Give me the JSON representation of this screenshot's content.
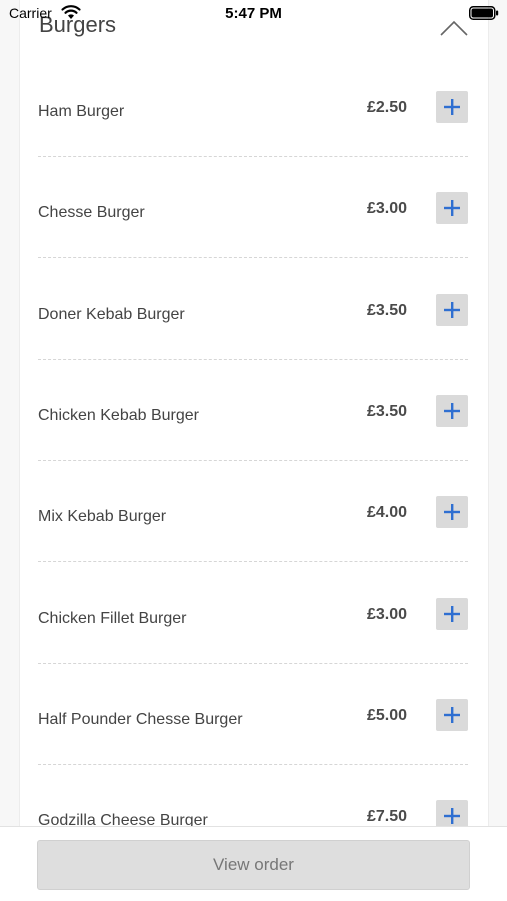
{
  "status_bar": {
    "carrier": "Carrier",
    "time": "5:47 PM"
  },
  "menu": {
    "section_title": "Burgers",
    "items": [
      {
        "name": "Ham Burger",
        "price": "£2.50"
      },
      {
        "name": "Chesse Burger",
        "price": "£3.00"
      },
      {
        "name": "Doner Kebab Burger",
        "price": "£3.50"
      },
      {
        "name": "Chicken Kebab Burger",
        "price": "£3.50"
      },
      {
        "name": "Mix Kebab Burger",
        "price": "£4.00"
      },
      {
        "name": "Chicken Fillet Burger",
        "price": "£3.00"
      },
      {
        "name": "Half Pounder Chesse Burger",
        "price": "£5.00"
      },
      {
        "name": "Godzilla Cheese Burger",
        "price": "£7.50"
      }
    ]
  },
  "footer": {
    "view_order_label": "View order"
  },
  "colors": {
    "accent": "#2f6fd1",
    "add_button_bg": "#dadada",
    "view_order_bg": "#dedede"
  },
  "icons": {
    "collapse": "chevron-up-icon",
    "add": "plus-icon",
    "wifi": "wifi-icon",
    "battery": "battery-icon"
  }
}
